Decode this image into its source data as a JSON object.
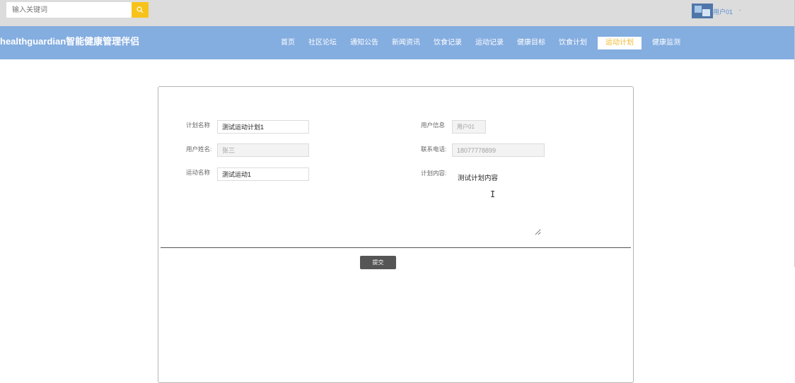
{
  "search": {
    "placeholder": "输入关键词"
  },
  "user": {
    "name": "用户01",
    "caret": "-"
  },
  "header": {
    "title": "healthguardian智能健康管理伴侣"
  },
  "nav": {
    "items": [
      {
        "label": "首页"
      },
      {
        "label": "社区论坛"
      },
      {
        "label": "通知公告"
      },
      {
        "label": "新闻资讯"
      },
      {
        "label": "饮食记录"
      },
      {
        "label": "运动记录"
      },
      {
        "label": "健康目标"
      },
      {
        "label": "饮食计划"
      },
      {
        "label": "运动计划",
        "active": true
      },
      {
        "label": "健康监测"
      }
    ]
  },
  "form": {
    "plan_name": {
      "label": "计划名称",
      "value": "测试运动计划1"
    },
    "user_info": {
      "label": "用户信息",
      "value": "用户01"
    },
    "user_name": {
      "label": "用户姓名:",
      "value": "张三"
    },
    "phone": {
      "label": "联系电话:",
      "value": "18077778899"
    },
    "exercise_name": {
      "label": "运动名称",
      "value": "测试运动1"
    },
    "plan_content": {
      "label": "计划内容:",
      "value": "测试计划内容"
    },
    "submit_label": "提交"
  },
  "colors": {
    "header_bg": "#84ade0",
    "topbar_bg": "#dcdcdc",
    "accent": "#f7c31a",
    "active_nav_text": "#f2b82c",
    "submit_bg": "#555555"
  }
}
